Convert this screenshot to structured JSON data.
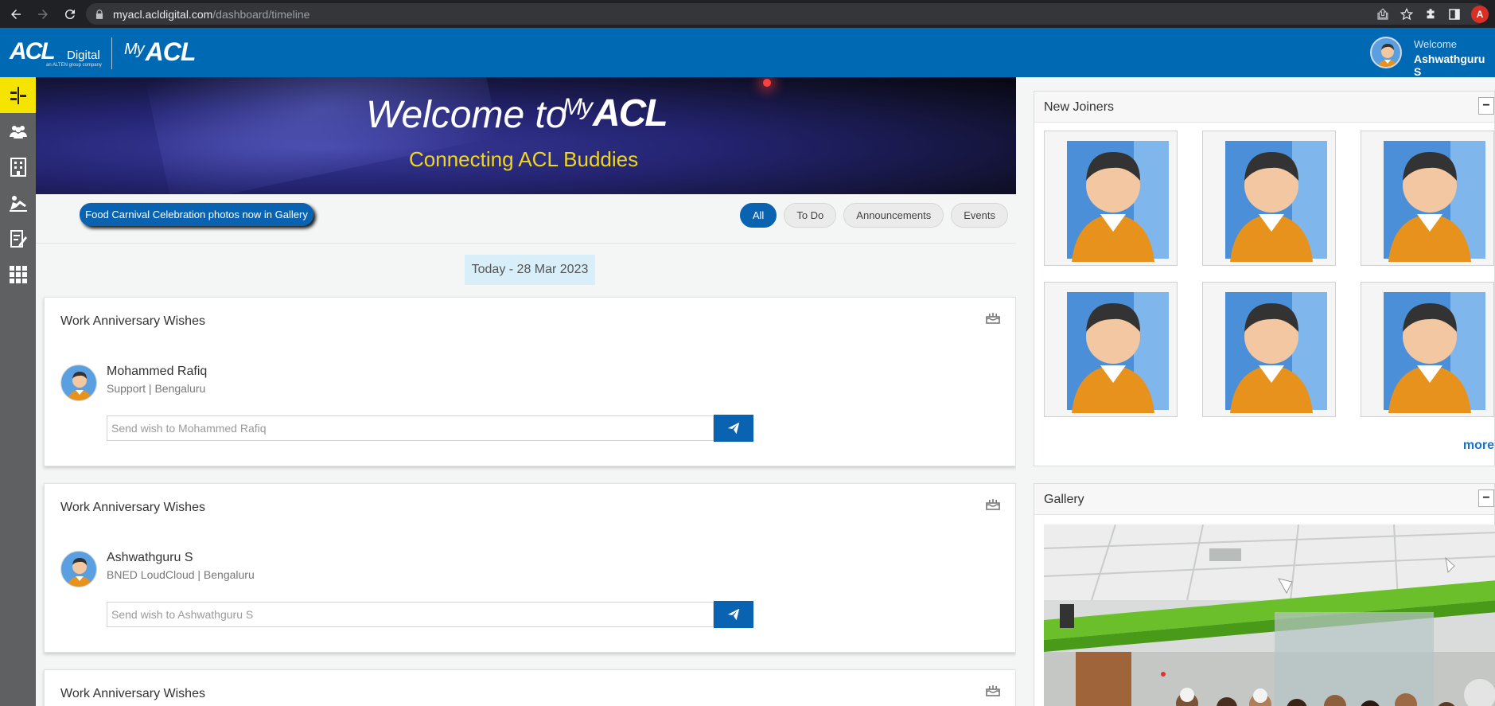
{
  "browser": {
    "url_host": "myacl.acldigital.com",
    "url_path": "/dashboard/timeline",
    "profile_initial": "A"
  },
  "header": {
    "logo_company": "ACL",
    "logo_digital": "Digital",
    "logo_tagline": "an ALTEN group company",
    "logo_app_prefix": "My",
    "logo_app_name": "ACL",
    "welcome_label": "Welcome",
    "user_name": "Ashwathguru S"
  },
  "sidebar": {
    "items": [
      {
        "icon": "timeline-icon",
        "active": true
      },
      {
        "icon": "people-icon",
        "active": false
      },
      {
        "icon": "building-icon",
        "active": false
      },
      {
        "icon": "leave-icon",
        "active": false
      },
      {
        "icon": "form-edit-icon",
        "active": false
      },
      {
        "icon": "apps-grid-icon",
        "active": false
      }
    ]
  },
  "banner": {
    "title": "Welcome to",
    "logo_prefix": "My",
    "logo_name": "ACL",
    "subtitle": "Connecting ACL Buddies"
  },
  "ticker": {
    "text": "Food Carnival Celebration photos now in Gallery"
  },
  "filters": [
    {
      "label": "All",
      "active": true
    },
    {
      "label": "To Do",
      "active": false
    },
    {
      "label": "Announcements",
      "active": false
    },
    {
      "label": "Events",
      "active": false
    }
  ],
  "timeline": {
    "date_label": "Today - 28 Mar 2023",
    "cards": [
      {
        "title": "Work Anniversary Wishes",
        "name": "Mohammed Rafiq",
        "meta": "Support | Bengaluru",
        "placeholder": "Send wish to Mohammed Rafiq"
      },
      {
        "title": "Work Anniversary Wishes",
        "name": "Ashwathguru S",
        "meta": "BNED LoudCloud | Bengaluru",
        "placeholder": "Send wish to Ashwathguru S"
      },
      {
        "title": "Work Anniversary Wishes"
      }
    ]
  },
  "new_joiners": {
    "title": "New Joiners",
    "collapse_symbol": "−",
    "more_label": "more"
  },
  "gallery": {
    "title": "Gallery",
    "collapse_symbol": "−"
  },
  "colors": {
    "brand_blue": "#0069b4",
    "accent_yellow": "#f5e400",
    "button_blue": "#0a63b0",
    "banner_subtitle": "#f0d71c"
  }
}
